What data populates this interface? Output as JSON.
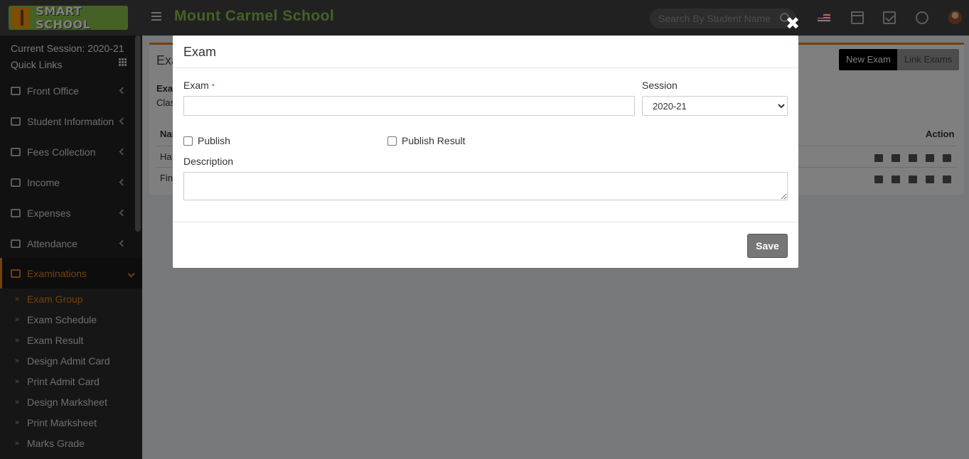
{
  "header": {
    "logo_text": "SMART SCHOOL",
    "school_name": "Mount Carmel School",
    "search_placeholder": "Search By Student Name"
  },
  "sidebar": {
    "session_label": "Current Session: 2020-21",
    "quick_links": "Quick Links",
    "items": [
      {
        "label": "Front Office",
        "icon": "front-office-icon"
      },
      {
        "label": "Student Information",
        "icon": "user-plus-icon"
      },
      {
        "label": "Fees Collection",
        "icon": "money-icon"
      },
      {
        "label": "Income",
        "icon": "dollar-icon"
      },
      {
        "label": "Expenses",
        "icon": "credit-card-icon"
      },
      {
        "label": "Attendance",
        "icon": "calendar-check-icon"
      },
      {
        "label": "Examinations",
        "icon": "map-icon",
        "active": true
      }
    ],
    "sub_items": [
      {
        "label": "Exam Group",
        "active": true
      },
      {
        "label": "Exam Schedule"
      },
      {
        "label": "Exam Result"
      },
      {
        "label": "Design Admit Card"
      },
      {
        "label": "Print Admit Card"
      },
      {
        "label": "Design Marksheet"
      },
      {
        "label": "Print Marksheet"
      },
      {
        "label": "Marks Grade"
      }
    ]
  },
  "background": {
    "box_title": "Exa",
    "line1": "Exa",
    "line2": "Clas",
    "col_name": "Nar",
    "row1": "Ha",
    "row2": "Fin",
    "action_header": "Action",
    "new_exam": "New Exam",
    "link_exams": "Link Exams"
  },
  "modal": {
    "title": "Exam",
    "close_symbol": "✖",
    "exam_label": "Exam",
    "required_mark": "*",
    "exam_value": "",
    "session_label": "Session",
    "session_value": "2020-21",
    "publish_label": "Publish",
    "publish_result_label": "Publish Result",
    "description_label": "Description",
    "description_value": "",
    "save_label": "Save"
  },
  "colors": {
    "accent": "#e98215",
    "brand_green": "#8bc34a",
    "header_bg": "#424242",
    "sidebar_bg": "#222222"
  }
}
